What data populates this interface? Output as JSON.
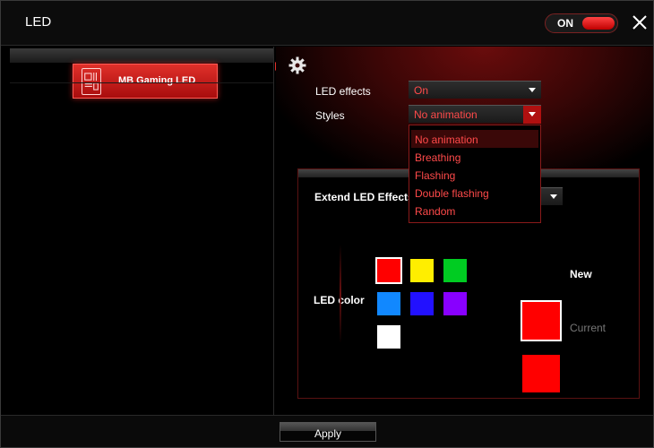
{
  "window": {
    "title": "LED",
    "power_toggle_label": "ON"
  },
  "sidebar": {
    "items": [
      {
        "label": "MB Gaming LED",
        "icon": "motherboard-icon",
        "selected": true
      }
    ]
  },
  "settings": {
    "led_effects_label": "LED effects",
    "led_effects_value": "On",
    "styles_label": "Styles",
    "styles_value": "No animation",
    "styles_options": [
      "No animation",
      "Breathing",
      "Flashing",
      "Double flashing",
      "Random"
    ],
    "extend_label": "Extend LED Effects"
  },
  "led_color": {
    "label": "LED color",
    "swatches": [
      "#ff0000",
      "#ffee00",
      "#00cc22",
      "#1188ff",
      "#2211ff",
      "#8800ff",
      "#ffffff"
    ],
    "selected_swatch": "#ff0000",
    "new_label": "New",
    "new_color": "#ff0000",
    "current_label": "Current",
    "current_color": "#ff0000"
  },
  "footer": {
    "apply_label": "Apply"
  },
  "colors": {
    "accent": "#e3302a",
    "text_accent": "#ff4a4a"
  }
}
